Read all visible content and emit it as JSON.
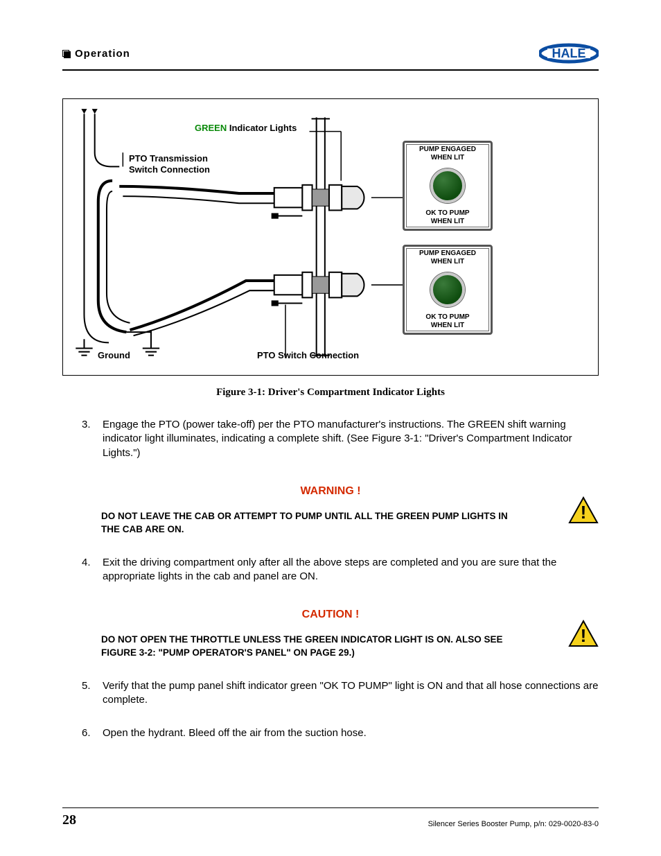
{
  "header": {
    "section": "Operation",
    "logo_text": "HALE"
  },
  "figure": {
    "caption": "Figure 3-1: Driver's Compartment Indicator Lights",
    "labels": {
      "green_indicator": "Indicator Lights",
      "green_word": "GREEN",
      "pto_trans": "PTO Transmission",
      "switch_conn": "Switch Connection",
      "ground": "Ground",
      "pto_switch": "PTO Switch Connection"
    },
    "status_box": {
      "top": "PUMP ENGAGED",
      "top2": "WHEN LIT",
      "bottom": "OK TO PUMP",
      "bottom2": "WHEN LIT"
    }
  },
  "steps": {
    "s3_num": "3.",
    "s3_text": "Engage the PTO (power take-off) per the PTO manufacturer's instructions. The GREEN shift warning indicator light illuminates, indicating a complete shift.   (See Figure 3-1: \"Driver's Compartment Indicator Lights.\")",
    "s4_num": "4.",
    "s4_text": "Exit the driving compartment only after all the above steps are completed and you are sure that the appropriate lights in the cab and panel are ON.",
    "s5_num": "5.",
    "s5_text": "Verify that the pump panel shift indicator green \"OK TO PUMP\" light is ON and that all hose connections are complete.",
    "s6_num": "6.",
    "s6_text": "Open the hydrant.  Bleed off the air from the suction hose."
  },
  "alerts": {
    "warning_title": "WARNING !",
    "warning_body": "DO NOT LEAVE THE CAB OR ATTEMPT TO PUMP UNTIL ALL THE GREEN PUMP LIGHTS IN THE CAB ARE ON.",
    "caution_title": "CAUTION !",
    "caution_body": "DO NOT OPEN THE THROTTLE UNLESS THE GREEN INDICATOR LIGHT IS ON.  ALSO SEE FIGURE 3-2: \"PUMP OPERATOR'S PANEL\" ON PAGE 29.)"
  },
  "footer": {
    "page": "28",
    "text": "Silencer Series Booster Pump, p/n: 029-0020-83-0"
  }
}
